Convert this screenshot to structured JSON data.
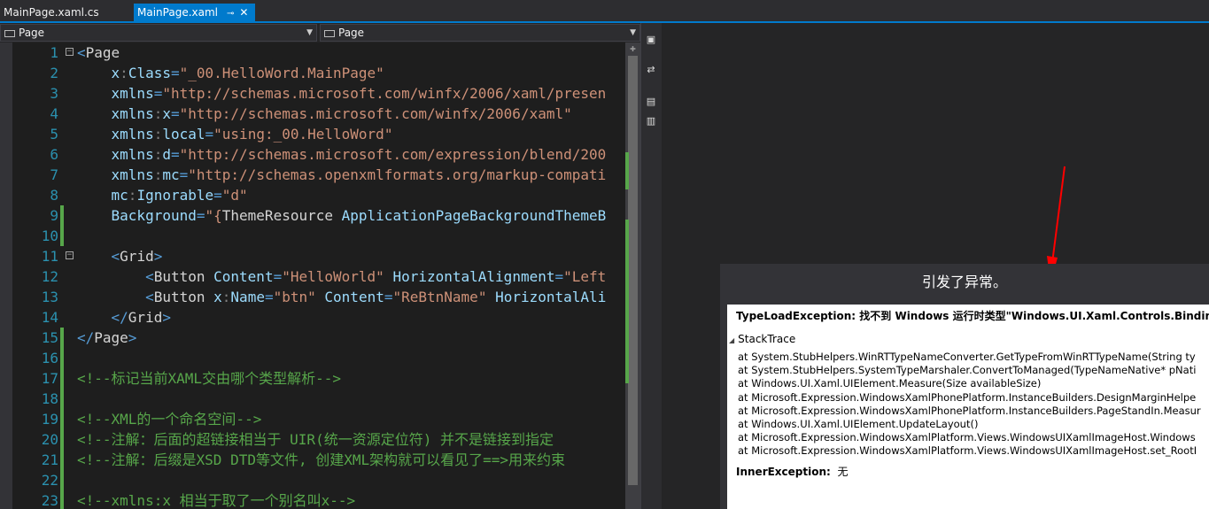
{
  "tabs": [
    {
      "label": "MainPage.xaml.cs",
      "active": false
    },
    {
      "label": "MainPage.xaml",
      "active": true
    }
  ],
  "pin_glyph": "⊸",
  "close_glyph": "✕",
  "navbar": {
    "left": "Page",
    "right": "Page"
  },
  "editor": {
    "lines": [
      {
        "n": "1",
        "fold": "⊟",
        "chg": "",
        "tokens": [
          [
            "t-tag",
            "<"
          ],
          [
            "t-el",
            "Page"
          ]
        ]
      },
      {
        "n": "2",
        "fold": "",
        "chg": "",
        "tokens": [
          [
            "t-el",
            "    "
          ],
          [
            "t-attr",
            "x"
          ],
          [
            "t-pn",
            ":"
          ],
          [
            "t-attr",
            "Class"
          ],
          [
            "t-tag",
            "="
          ],
          [
            "t-val",
            "\"_00.HelloWord.MainPage\""
          ]
        ]
      },
      {
        "n": "3",
        "fold": "",
        "chg": "",
        "tokens": [
          [
            "t-el",
            "    "
          ],
          [
            "t-attr",
            "xmlns"
          ],
          [
            "t-tag",
            "="
          ],
          [
            "t-val",
            "\"http://schemas.microsoft.com/winfx/2006/xaml/presen"
          ]
        ]
      },
      {
        "n": "4",
        "fold": "",
        "chg": "",
        "tokens": [
          [
            "t-el",
            "    "
          ],
          [
            "t-attr",
            "xmlns"
          ],
          [
            "t-pn",
            ":"
          ],
          [
            "t-attr",
            "x"
          ],
          [
            "t-tag",
            "="
          ],
          [
            "t-val",
            "\"http://schemas.microsoft.com/winfx/2006/xaml\""
          ]
        ]
      },
      {
        "n": "5",
        "fold": "",
        "chg": "",
        "tokens": [
          [
            "t-el",
            "    "
          ],
          [
            "t-attr",
            "xmlns"
          ],
          [
            "t-pn",
            ":"
          ],
          [
            "t-attr",
            "local"
          ],
          [
            "t-tag",
            "="
          ],
          [
            "t-val",
            "\"using:_00.HelloWord\""
          ]
        ]
      },
      {
        "n": "6",
        "fold": "",
        "chg": "",
        "tokens": [
          [
            "t-el",
            "    "
          ],
          [
            "t-attr",
            "xmlns"
          ],
          [
            "t-pn",
            ":"
          ],
          [
            "t-attr",
            "d"
          ],
          [
            "t-tag",
            "="
          ],
          [
            "t-val",
            "\"http://schemas.microsoft.com/expression/blend/200"
          ]
        ]
      },
      {
        "n": "7",
        "fold": "",
        "chg": "",
        "tokens": [
          [
            "t-el",
            "    "
          ],
          [
            "t-attr",
            "xmlns"
          ],
          [
            "t-pn",
            ":"
          ],
          [
            "t-attr",
            "mc"
          ],
          [
            "t-tag",
            "="
          ],
          [
            "t-val",
            "\"http://schemas.openxmlformats.org/markup-compati"
          ]
        ]
      },
      {
        "n": "8",
        "fold": "",
        "chg": "",
        "tokens": [
          [
            "t-el",
            "    "
          ],
          [
            "t-attr",
            "mc"
          ],
          [
            "t-pn",
            ":"
          ],
          [
            "t-attr",
            "Ignorable"
          ],
          [
            "t-tag",
            "="
          ],
          [
            "t-val",
            "\"d\""
          ]
        ]
      },
      {
        "n": "9",
        "fold": "",
        "chg": "green",
        "tokens": [
          [
            "t-el",
            "    "
          ],
          [
            "t-attr",
            "Background"
          ],
          [
            "t-tag",
            "="
          ],
          [
            "t-val",
            "\"{"
          ],
          [
            "t-el",
            "ThemeResource"
          ],
          [
            "t-el",
            " "
          ],
          [
            "t-attr",
            "ApplicationPageBackgroundThemeB"
          ]
        ]
      },
      {
        "n": "10",
        "fold": "",
        "chg": "green",
        "tokens": []
      },
      {
        "n": "11",
        "fold": "⊟",
        "chg": "",
        "tokens": [
          [
            "t-el",
            "    "
          ],
          [
            "t-tag",
            "<"
          ],
          [
            "t-el",
            "Grid"
          ],
          [
            "t-tag",
            ">"
          ]
        ]
      },
      {
        "n": "12",
        "fold": "",
        "chg": "",
        "tokens": [
          [
            "t-el",
            "        "
          ],
          [
            "t-tag",
            "<"
          ],
          [
            "t-el",
            "Button"
          ],
          [
            "t-el",
            " "
          ],
          [
            "t-attr",
            "Content"
          ],
          [
            "t-tag",
            "="
          ],
          [
            "t-val",
            "\"HelloWorld\""
          ],
          [
            "t-el",
            " "
          ],
          [
            "t-attr",
            "HorizontalAlignment"
          ],
          [
            "t-tag",
            "="
          ],
          [
            "t-val",
            "\"Left"
          ]
        ]
      },
      {
        "n": "13",
        "fold": "",
        "chg": "",
        "tokens": [
          [
            "t-el",
            "        "
          ],
          [
            "t-tag",
            "<"
          ],
          [
            "t-el",
            "Button"
          ],
          [
            "t-el",
            " "
          ],
          [
            "t-attr",
            "x"
          ],
          [
            "t-pn",
            ":"
          ],
          [
            "t-attr",
            "Name"
          ],
          [
            "t-tag",
            "="
          ],
          [
            "t-val",
            "\"btn\""
          ],
          [
            "t-el",
            " "
          ],
          [
            "t-attr",
            "Content"
          ],
          [
            "t-tag",
            "="
          ],
          [
            "t-val",
            "\"ReBtnName\""
          ],
          [
            "t-el",
            " "
          ],
          [
            "t-attr",
            "HorizontalAli"
          ]
        ]
      },
      {
        "n": "14",
        "fold": "",
        "chg": "",
        "tokens": [
          [
            "t-el",
            "    "
          ],
          [
            "t-tag",
            "</"
          ],
          [
            "t-el",
            "Grid"
          ],
          [
            "t-tag",
            ">"
          ]
        ]
      },
      {
        "n": "15",
        "fold": "",
        "chg": "green",
        "tokens": [
          [
            "t-tag",
            "</"
          ],
          [
            "t-el",
            "Page"
          ],
          [
            "t-tag",
            ">"
          ]
        ]
      },
      {
        "n": "16",
        "fold": "",
        "chg": "green",
        "tokens": []
      },
      {
        "n": "17",
        "fold": "",
        "chg": "green",
        "tokens": [
          [
            "t-cm",
            "<!--标记当前XAML交由哪个类型解析-->"
          ]
        ]
      },
      {
        "n": "18",
        "fold": "",
        "chg": "green",
        "tokens": []
      },
      {
        "n": "19",
        "fold": "",
        "chg": "green",
        "tokens": [
          [
            "t-cm",
            "<!--XML的一个命名空间-->"
          ]
        ]
      },
      {
        "n": "20",
        "fold": "",
        "chg": "green",
        "tokens": [
          [
            "t-cm",
            "<!--注解：后面的超链接相当于 UIR(统一资源定位符) 并不是链接到指定"
          ]
        ]
      },
      {
        "n": "21",
        "fold": "",
        "chg": "green",
        "tokens": [
          [
            "t-cm",
            "<!--注解：后缀是XSD DTD等文件, 创建XML架构就可以看见了==>用来约束"
          ]
        ]
      },
      {
        "n": "22",
        "fold": "",
        "chg": "green",
        "tokens": []
      },
      {
        "n": "23",
        "fold": "",
        "chg": "green",
        "tokens": [
          [
            "t-cm",
            "<!--xmlns:x 相当于取了一个别名叫x-->"
          ]
        ]
      }
    ]
  },
  "toolstrip_icons": [
    "restore-icon",
    "swap-panes-icon",
    "design-view-icon",
    "xaml-view-icon"
  ],
  "error": {
    "title": "引发了异常。",
    "header": "TypeLoadException: 找不到 Windows 运行时类型\"Windows.UI.Xaml.Controls.Binding\"。",
    "stacktrace_label": "StackTrace",
    "stack": [
      "at System.StubHelpers.WinRTTypeNameConverter.GetTypeFromWinRTTypeName(String ty",
      "at System.StubHelpers.SystemTypeMarshaler.ConvertToManaged(TypeNameNative* pNati",
      "at Windows.UI.Xaml.UIElement.Measure(Size availableSize)",
      "at Microsoft.Expression.WindowsXamlPhonePlatform.InstanceBuilders.DesignMarginHelpe",
      "at Microsoft.Expression.WindowsXamlPhonePlatform.InstanceBuilders.PageStandIn.Measur",
      "at Windows.UI.Xaml.UIElement.UpdateLayout()",
      "at Microsoft.Expression.WindowsXamlPlatform.Views.WindowsUIXamlImageHost.Windows",
      "at Microsoft.Expression.WindowsXamlPlatform.Views.WindowsUIXamlImageHost.set_RootI"
    ],
    "inner_label": "InnerException:",
    "inner_value": "无"
  },
  "colors": {
    "accent": "#007acc",
    "annotation_arrow": "#ff0000",
    "change_bar": "#57a64a"
  }
}
